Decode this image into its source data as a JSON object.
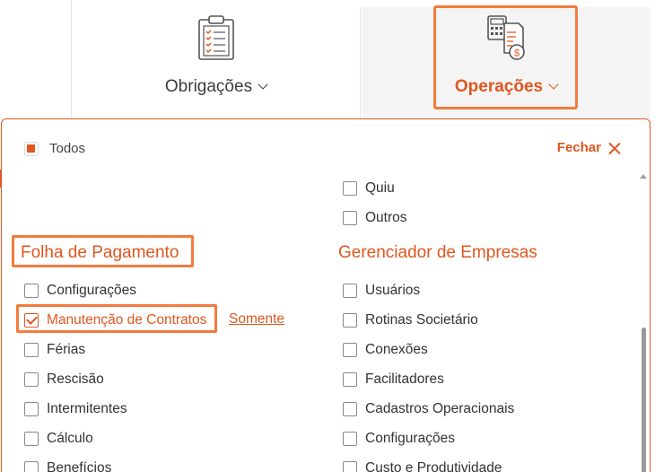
{
  "nav": {
    "obrigacoes": {
      "label": "Obrigações",
      "icon": "clipboard-checklist-icon"
    },
    "operacoes": {
      "label": "Operações",
      "icon": "calculator-invoice-dollar-icon",
      "active": true
    }
  },
  "panel": {
    "todos_label": "Todos",
    "fechar_label": "Fechar",
    "top_items": [
      "Quiu",
      "Outros"
    ],
    "folha": {
      "title": "Folha de Pagamento",
      "items": [
        {
          "label": "Configurações",
          "checked": false
        },
        {
          "label": "Manutenção de Contratos",
          "checked": true
        },
        {
          "label": "Férias",
          "checked": false
        },
        {
          "label": "Rescisão",
          "checked": false
        },
        {
          "label": "Intermitentes",
          "checked": false
        },
        {
          "label": "Cálculo",
          "checked": false
        },
        {
          "label": "Benefícios",
          "checked": false
        }
      ],
      "somente_label": "Somente"
    },
    "gerenciador": {
      "title": "Gerenciador de Empresas",
      "items": [
        {
          "label": "Usuários",
          "checked": false
        },
        {
          "label": "Rotinas Societário",
          "checked": false
        },
        {
          "label": "Conexões",
          "checked": false
        },
        {
          "label": "Facilitadores",
          "checked": false
        },
        {
          "label": "Cadastros Operacionais",
          "checked": false
        },
        {
          "label": "Configurações",
          "checked": false
        },
        {
          "label": "Custo e Produtividade",
          "checked": false
        }
      ]
    }
  },
  "colors": {
    "accent": "#e0561f",
    "highlight": "#f37b3d",
    "text": "#333333"
  }
}
